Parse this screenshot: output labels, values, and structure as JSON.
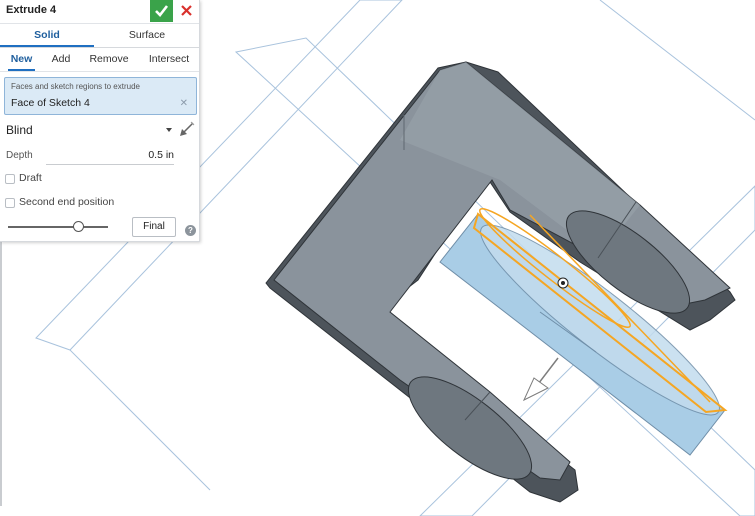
{
  "feature": {
    "title": "Extrude 4",
    "accept_icon": "checkmark-icon",
    "cancel_icon": "close-icon"
  },
  "type_tabs": [
    {
      "label": "Solid",
      "active": true
    },
    {
      "label": "Surface",
      "active": false
    }
  ],
  "operation_tabs": [
    {
      "label": "New",
      "active": true
    },
    {
      "label": "Add",
      "active": false
    },
    {
      "label": "Remove",
      "active": false
    },
    {
      "label": "Intersect",
      "active": false
    }
  ],
  "selection": {
    "label": "Faces and sketch regions to extrude",
    "value": "Face of Sketch 4",
    "clear_icon": "close-icon"
  },
  "end_type": {
    "value": "Blind",
    "flip_icon": "flip-direction-icon"
  },
  "depth": {
    "label": "Depth",
    "value": "0.5 in"
  },
  "options": {
    "draft_label": "Draft",
    "draft_checked": false,
    "second_end_label": "Second end position",
    "second_end_checked": false
  },
  "footer": {
    "final_label": "Final",
    "help_label": "?"
  },
  "colors": {
    "accept": "#3aa34a",
    "cancel": "#d9302c",
    "accent": "#1f6fc1",
    "part_gray": "#7d868f",
    "preview_blue": "#a9cde6",
    "highlight_orange": "#f5a623"
  }
}
